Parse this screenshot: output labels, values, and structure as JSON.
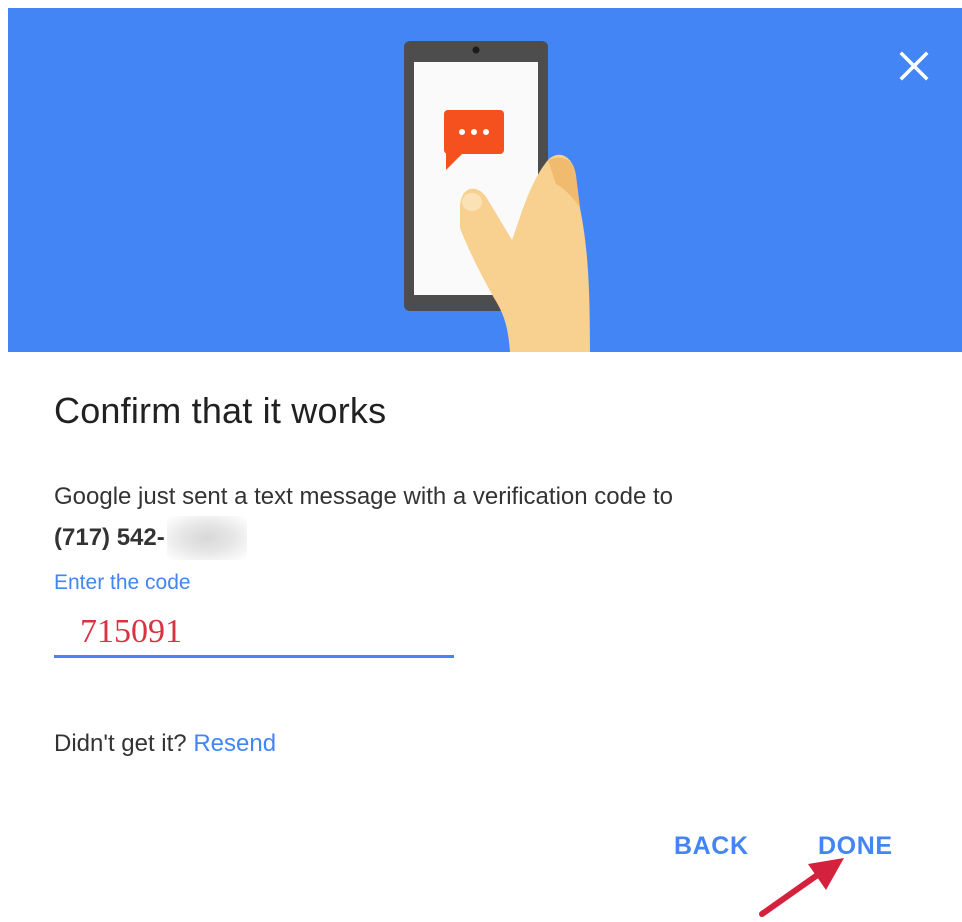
{
  "dialog": {
    "title": "Confirm that it works",
    "message": "Google just sent a text message with a verification code to",
    "phone_number": "(717) 542-",
    "code_label": "Enter the code",
    "code_value": "715091",
    "resend_prompt": "Didn't get it? ",
    "resend_link": "Resend",
    "back_label": "BACK",
    "done_label": "DONE"
  },
  "icons": {
    "close": "close-icon",
    "illustration": "phone-sms-illustration",
    "annotation": "red-arrow-icon"
  },
  "colors": {
    "hero_background": "#4385f4",
    "accent": "#4385f4",
    "sms_bubble": "#f4511e",
    "code_text": "#d93342",
    "annotation_arrow": "#d4213d"
  }
}
